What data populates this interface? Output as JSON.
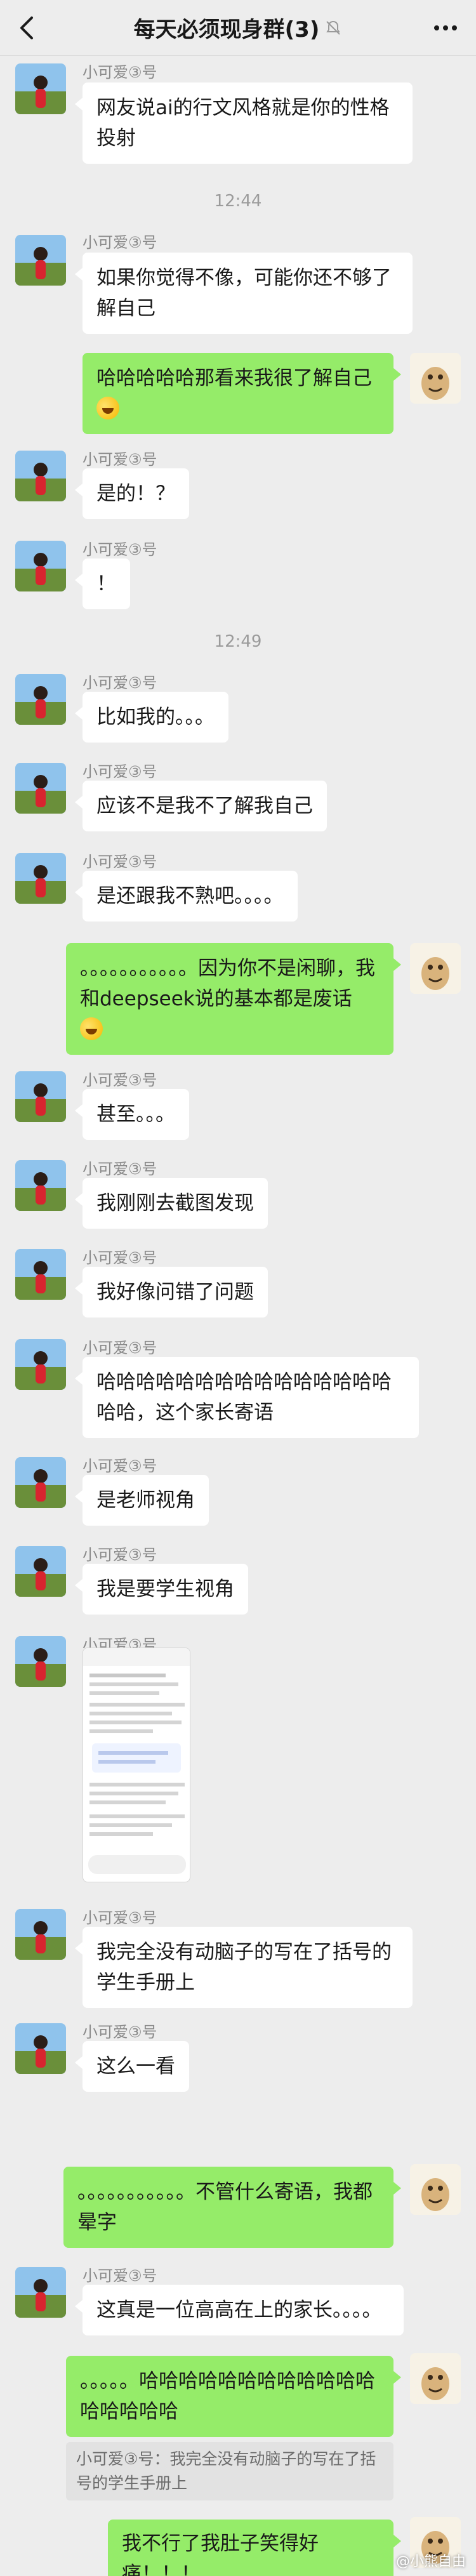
{
  "header": {
    "title": "每天必须现身群(3)"
  },
  "nickname": "小可爱③号",
  "messages": [
    {
      "side": "in",
      "text": "网友说ai的行文风格就是你的性格投射"
    },
    {
      "side": "in",
      "text": "如果你觉得不像，可能你还不够了解自己"
    },
    {
      "side": "out",
      "text": "哈哈哈哈哈那看来我很了解自己"
    },
    {
      "side": "in",
      "text": "是的！？"
    },
    {
      "side": "in",
      "text": "！"
    },
    {
      "side": "in",
      "text": "比如我的。。。"
    },
    {
      "side": "in",
      "text": "应该不是我不了解我自己"
    },
    {
      "side": "in",
      "text": "是还跟我不熟吧。。。。"
    },
    {
      "side": "out",
      "text": "。。。。。。。。。。。因为你不是闲聊，我和deepseek说的基本都是废话"
    },
    {
      "side": "in",
      "text": "甚至。。。"
    },
    {
      "side": "in",
      "text": "我刚刚去截图发现"
    },
    {
      "side": "in",
      "text": "我好像问错了问题"
    },
    {
      "side": "in",
      "text": "哈哈哈哈哈哈哈哈哈哈哈哈哈哈哈哈哈，这个家长寄语"
    },
    {
      "side": "in",
      "text": "是老师视角"
    },
    {
      "side": "in",
      "text": "我是要学生视角"
    },
    {
      "side": "in",
      "text": "我完全没有动脑子的写在了括号的学生手册上"
    },
    {
      "side": "in",
      "text": "这么一看"
    },
    {
      "side": "out",
      "text": "。。。。。。。。。。。不管什么寄语，我都晕字"
    },
    {
      "side": "in",
      "text": "这真是一位高高在上的家长。。。。"
    },
    {
      "side": "out",
      "text": "。。。。。哈哈哈哈哈哈哈哈哈哈哈哈哈哈哈哈哈"
    },
    {
      "side": "out",
      "text": "我不行了我肚子笑得好痛！！！"
    }
  ],
  "quote": {
    "text": "小可爱③号：我完全没有动脑子的写在了括号的学生手册上"
  },
  "times": [
    "12:44",
    "12:49"
  ],
  "watermark": "@小熊自由",
  "colors": {
    "background": "#ededed",
    "incoming": "#ffffff",
    "outgoing": "#95ec69",
    "nickname": "#8a8a8a"
  },
  "icons": [
    "back-icon",
    "mute-icon",
    "more-icon",
    "laughing-emoji",
    "screenshot-image"
  ]
}
